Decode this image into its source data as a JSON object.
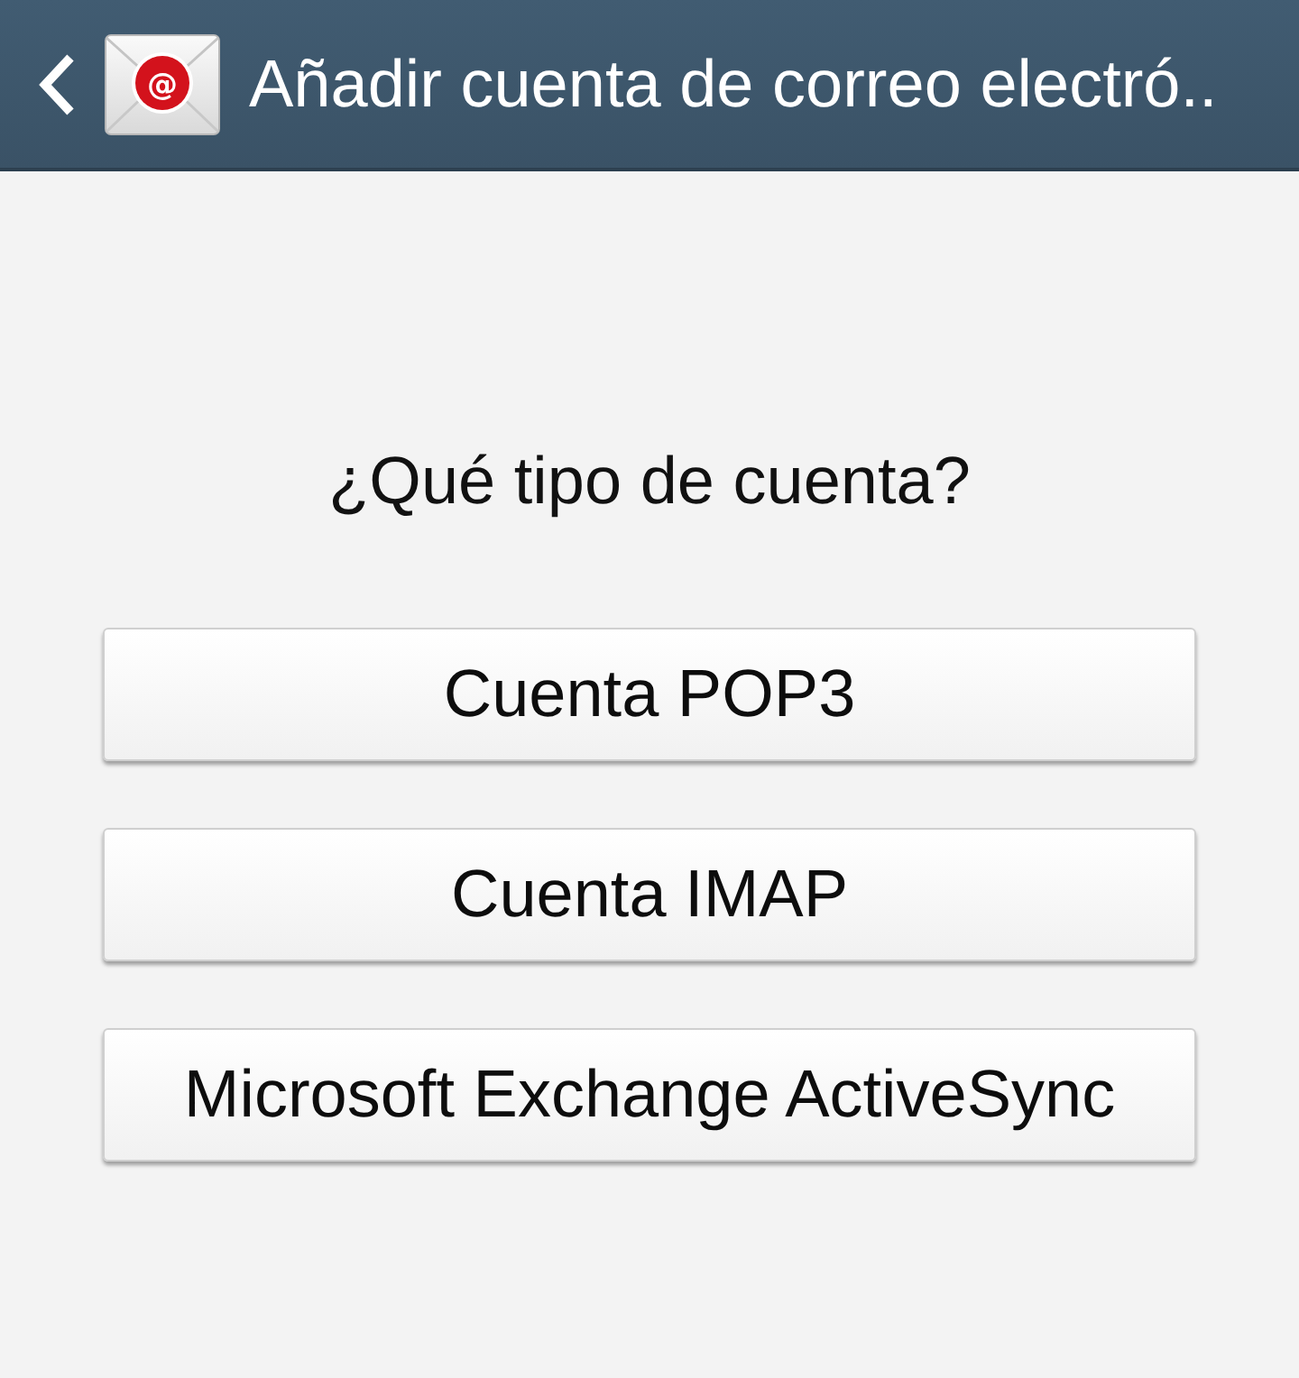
{
  "header": {
    "title": "Añadir cuenta de correo electró..",
    "app_icon_glyph": "@"
  },
  "question": "¿Qué tipo de cuenta?",
  "account_types": [
    {
      "label": "Cuenta POP3"
    },
    {
      "label": "Cuenta IMAP"
    },
    {
      "label": "Microsoft Exchange ActiveSync"
    }
  ]
}
